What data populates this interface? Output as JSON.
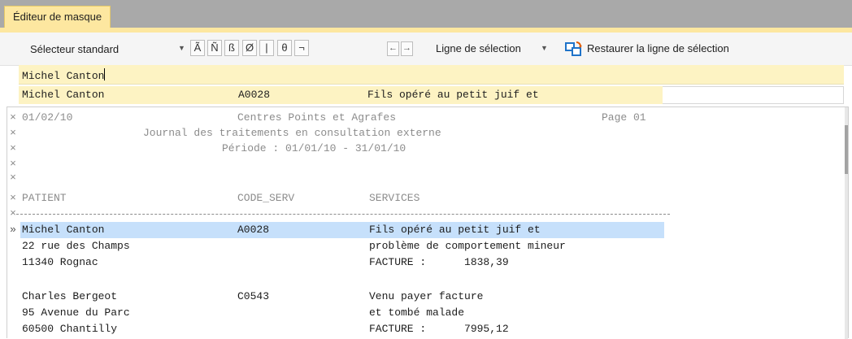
{
  "tab": {
    "title": "Éditeur de masque"
  },
  "toolbar": {
    "selector": "Sélecteur standard",
    "special_chars": [
      "Ã",
      "Ñ",
      "ß",
      "Ø",
      "|",
      "θ",
      "¬"
    ],
    "ligne_selection": "Ligne de sélection",
    "restore": "Restaurer la ligne de sélection"
  },
  "input": {
    "value": "Michel Canton"
  },
  "preview": {
    "name": "Michel Canton",
    "code": "A0028",
    "service": "Fils opéré au petit juif et"
  },
  "report": {
    "date": "01/02/10",
    "company": "Centres Points et Agrafes",
    "page": "Page 01",
    "journal": "Journal des traitements en consultation externe",
    "periode": "Période : 01/01/10 - 31/01/10",
    "headers": {
      "patient": "PATIENT",
      "code": "CODE_SERV",
      "services": "SERVICES"
    },
    "records": [
      {
        "lines": [
          {
            "left": "Michel Canton",
            "code": "A0028",
            "right": "Fils opéré au petit juif et"
          },
          {
            "left": "22 rue des Champs",
            "code": "",
            "right": "problème de comportement mineur"
          },
          {
            "left": "11340 Rognac",
            "code": "",
            "right": "FACTURE :      1838,39"
          }
        ]
      },
      {
        "lines": [
          {
            "left": "Charles Bergeot",
            "code": "C0543",
            "right": "Venu payer facture"
          },
          {
            "left": "95 Avenue du Parc",
            "code": "",
            "right": "et tombé malade"
          },
          {
            "left": "60500 Chantilly",
            "code": "",
            "right": "FACTURE :      7995,12"
          }
        ]
      }
    ]
  }
}
